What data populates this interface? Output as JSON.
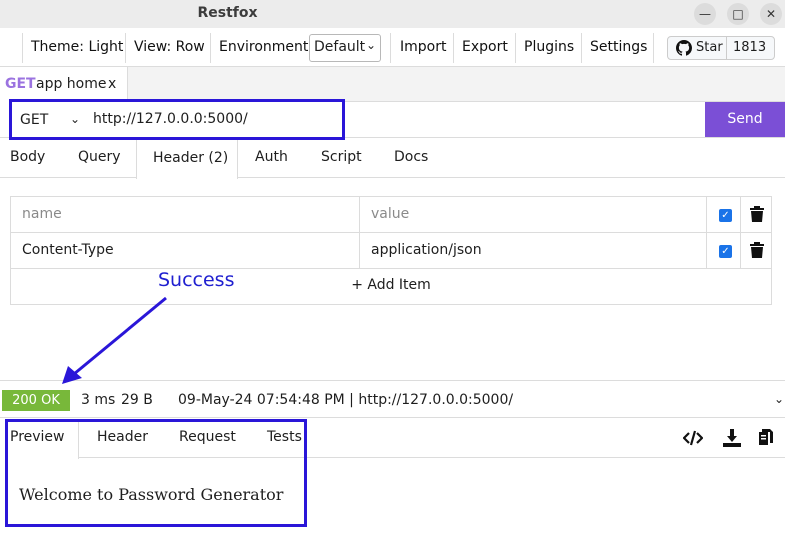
{
  "window": {
    "title": "Restfox"
  },
  "menu": {
    "theme": "Theme: Light",
    "view": "View: Row",
    "environment_label": "Environment",
    "environment_value": "Default",
    "import": "Import",
    "export": "Export",
    "plugins": "Plugins",
    "settings": "Settings",
    "star_label": "Star",
    "star_count": "1813"
  },
  "tab": {
    "method": "GET",
    "name": "app home",
    "close": "x"
  },
  "request": {
    "method": "GET",
    "url": "http://127.0.0.0:5000/",
    "send_label": "Send"
  },
  "request_tabs": [
    "Body",
    "Query",
    "Header (2)",
    "Auth",
    "Script",
    "Docs"
  ],
  "headers": {
    "name_placeholder": "name",
    "value_placeholder": "value",
    "rows": [
      {
        "name": "Content-Type",
        "value": "application/json"
      }
    ],
    "add_item": "+ Add Item"
  },
  "annotation": {
    "text": "Success"
  },
  "response": {
    "status": "200 OK",
    "time": "3 ms",
    "size": "29 B",
    "timestamp_url": "09-May-24 07:54:48 PM | http://127.0.0.0:5000/",
    "tabs": [
      "Preview",
      "Header",
      "Request",
      "Tests"
    ],
    "preview_text": "Welcome to Password Generator"
  },
  "colors": {
    "accent": "#7b4fd6",
    "status_ok": "#78b83a",
    "annotation": "#2a16d8"
  }
}
